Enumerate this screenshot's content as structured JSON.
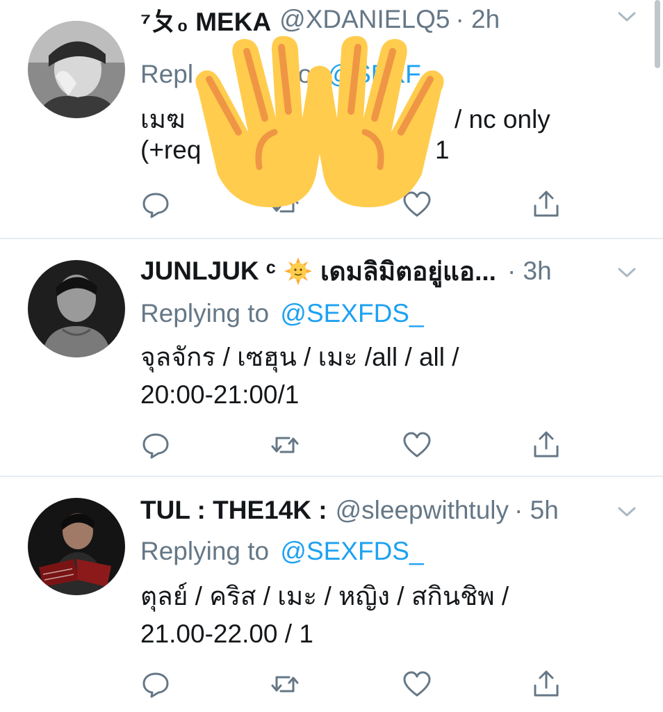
{
  "tweets": [
    {
      "name": "⁷ㄆ₀ MEKA",
      "handle": "@XDANIELQ5",
      "time": "· 2h",
      "replying_prefix": "Repl",
      "replying_suffix": "to",
      "mention": "@SEXF",
      "line1_a": "เมฆ",
      "line1_b": "s",
      "line1_c": "/ nc only",
      "line2_a": "(+req",
      "line2_b": "1"
    },
    {
      "name": "JUNLJUK ᶜ",
      "name_suffix": "เดมลิมิตอยู่แอ...",
      "handle": "",
      "time": "· 3h",
      "replying_prefix": "Replying to",
      "mention": "@SEXFDS_",
      "line1": "จุลจักร / เซฮุน / เมะ /all / all /",
      "line2": "20:00-21:00/1"
    },
    {
      "name": "TUL : THE14K :",
      "handle": "@sleepwithtuly",
      "time": "· 5h",
      "replying_prefix": "Replying to",
      "mention": "@SEXFDS_",
      "line1": "ตุลย์ / คริส / เมะ / หญิง / สกินชิพ /",
      "line2": "21.00-22.00 / 1"
    }
  ],
  "icons": {
    "reply": "reply-icon",
    "retweet": "retweet-icon",
    "like": "heart-icon",
    "share": "share-icon",
    "more": "chevron-down-icon",
    "overlay": "raising-hands-emoji",
    "sun": "sun-with-face-emoji"
  },
  "colors": {
    "text": "#14171a",
    "muted": "#657786",
    "link": "#1da1f2",
    "icon": "#657786",
    "divider": "#e6ecf0",
    "emoji_yellow": "#ffcc4d",
    "emoji_orange": "#ef9645"
  }
}
